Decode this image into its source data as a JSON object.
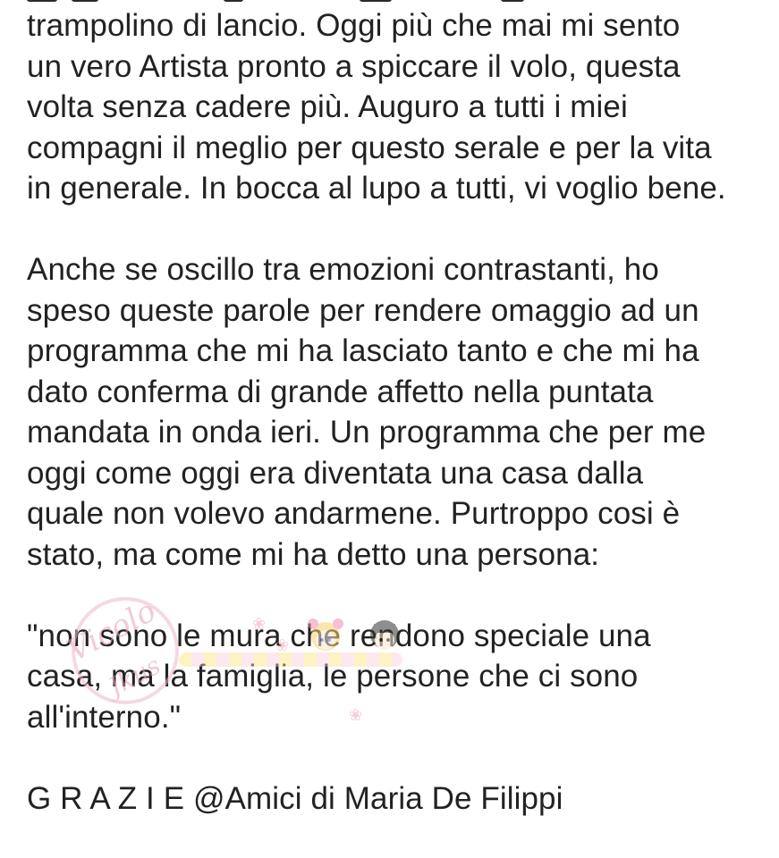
{
  "post": {
    "paragraph1": [
      "trampolino di lancio. Oggi più che mai mi sento",
      "un vero Artista pronto a spiccare il volo, questa",
      "volta senza cadere più. Auguro a tutti i miei",
      "compagni il meglio per questo serale e per la vita",
      "in generale. In bocca al lupo a tutti, vi voglio bene."
    ],
    "paragraph2": [
      "Anche se oscillo tra emozioni contrastanti, ho",
      "speso queste parole per rendere omaggio ad un",
      "programma che mi ha lasciato tanto e che mi ha",
      "dato conferma di grande affetto nella puntata",
      "mandata in onda ieri. Un programma che per me",
      "oggi come oggi era diventata una casa dalla",
      "quale non volevo andarmene. Purtroppo cosi è",
      "stato, ma come mi ha detto una persona:"
    ],
    "paragraph3": [
      "\"non sono le mura che rendono speciale una",
      "casa, ma la famiglia, le persone che ci sono",
      "all'interno.\""
    ],
    "signature": "G R A Z I E @Amici di Maria De Filippi"
  },
  "watermark": {
    "text_main": "Vicolo",
    "text_sub": "Jkus"
  },
  "colors": {
    "text": "#222222",
    "background": "#ffffff",
    "watermark_pink": "#e7a1bd"
  }
}
